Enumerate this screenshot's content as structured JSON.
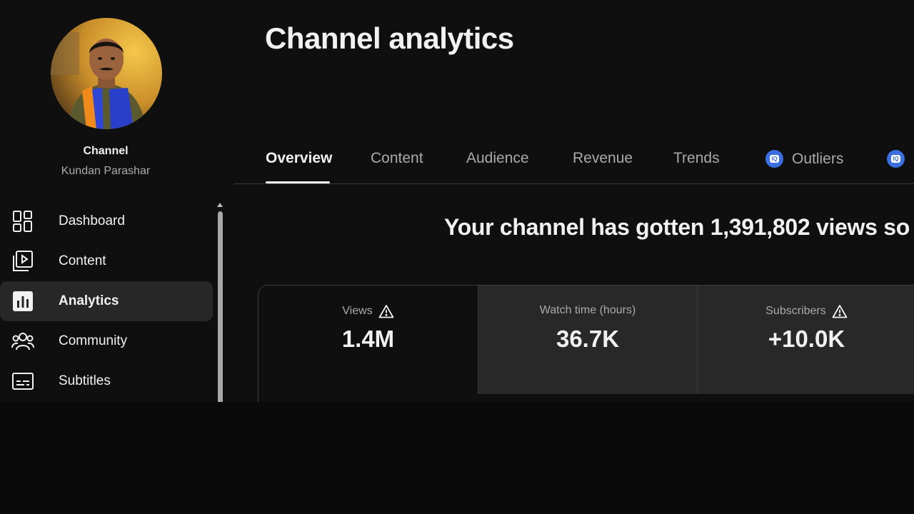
{
  "sidebar": {
    "channel_label": "Channel",
    "channel_name": "Kundan Parashar",
    "items": [
      {
        "label": "Dashboard",
        "icon": "dashboard-icon",
        "active": false
      },
      {
        "label": "Content",
        "icon": "content-icon",
        "active": false
      },
      {
        "label": "Analytics",
        "icon": "analytics-icon",
        "active": true
      },
      {
        "label": "Community",
        "icon": "community-icon",
        "active": false
      },
      {
        "label": "Subtitles",
        "icon": "subtitles-icon",
        "active": false
      }
    ]
  },
  "main": {
    "title": "Channel analytics",
    "tabs": [
      {
        "label": "Overview",
        "active": true
      },
      {
        "label": "Content",
        "active": false
      },
      {
        "label": "Audience",
        "active": false
      },
      {
        "label": "Revenue",
        "active": false
      },
      {
        "label": "Trends",
        "active": false
      },
      {
        "label": "Outliers",
        "active": false,
        "badge": "IQ"
      },
      {
        "label": "",
        "active": false,
        "badge": "IQ"
      }
    ],
    "headline": "Your channel has gotten 1,391,802 views so",
    "cards": [
      {
        "title": "Views",
        "value": "1.4M",
        "warning": true
      },
      {
        "title": "Watch time (hours)",
        "value": "36.7K",
        "warning": false
      },
      {
        "title": "Subscribers",
        "value": "+10.0K",
        "warning": true
      }
    ]
  },
  "colors": {
    "background": "#0f0f0f",
    "active_nav": "#272727",
    "card_alt": "#282828",
    "muted_text": "#aaaaaa",
    "accent_badge": "#3b6fe0"
  }
}
